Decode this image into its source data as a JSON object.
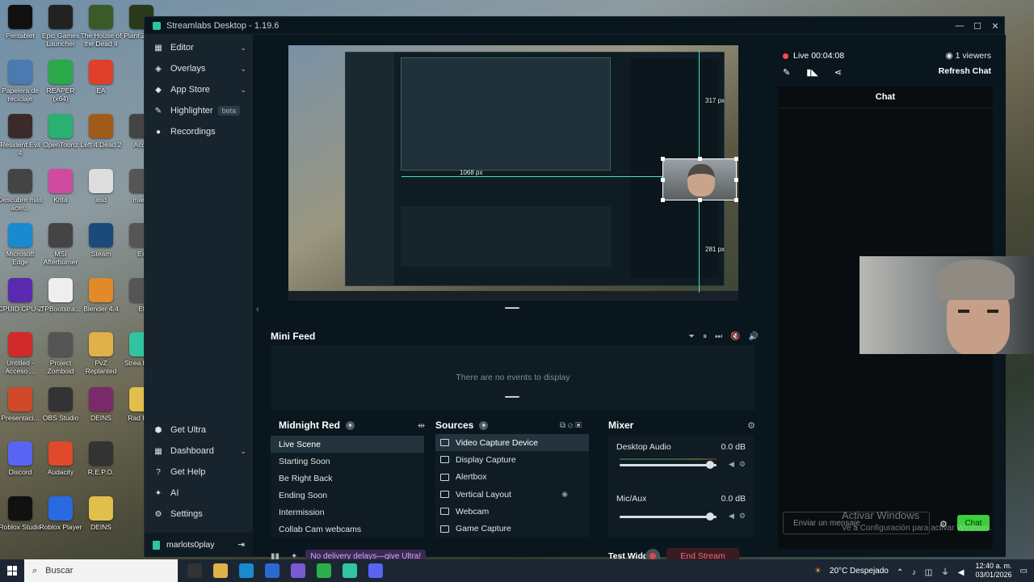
{
  "desktop": {
    "icons": [
      {
        "label": "Pentablet",
        "color": "#111"
      },
      {
        "label": "Epic Games Launcher",
        "color": "#222"
      },
      {
        "label": "The House of the Dead II",
        "color": "#3a5a2a"
      },
      {
        "label": "Plant Zomb",
        "color": "#2a3a1a"
      },
      {
        "label": "Papelera de reciclaje",
        "color": "#4a7ab0"
      },
      {
        "label": "REAPER (x64)",
        "color": "#2aa84a"
      },
      {
        "label": "EA",
        "color": "#e0402a"
      },
      {
        "label": "Resident Evil 4",
        "color": "#3a2a2a"
      },
      {
        "label": "OpenToonz",
        "color": "#2ab070"
      },
      {
        "label": "Left 4 Dead 2",
        "color": "#a05a1a"
      },
      {
        "label": "Acce",
        "color": "#444"
      },
      {
        "label": "Descubre más acer...",
        "color": "#444"
      },
      {
        "label": "Krita",
        "color": "#d04aa0"
      },
      {
        "label": "asd",
        "color": "#ddd"
      },
      {
        "label": "mand",
        "color": "#555"
      },
      {
        "label": "Microsoft Edge",
        "color": "#1a8ad0"
      },
      {
        "label": "MSI Afterburner",
        "color": "#444"
      },
      {
        "label": "Steam",
        "color": "#1a4a7a"
      },
      {
        "label": "Ex",
        "color": "#555"
      },
      {
        "label": "CPUID CPU-Z",
        "color": "#5a2ab0"
      },
      {
        "label": "TPBootstra...",
        "color": "#eee"
      },
      {
        "label": "Blender 4.4",
        "color": "#e08a2a"
      },
      {
        "label": "El",
        "color": "#555"
      },
      {
        "label": "Untitled - Acceso ...",
        "color": "#d02a2a"
      },
      {
        "label": "Project Zomboid",
        "color": "#555"
      },
      {
        "label": "PvZ Replanted",
        "color": "#e0b04a"
      },
      {
        "label": "Strea Desk",
        "color": "#31c3a2"
      },
      {
        "label": "Presentaci...",
        "color": "#d04a2a"
      },
      {
        "label": "OBS Studio",
        "color": "#333"
      },
      {
        "label": "DEINS",
        "color": "#7a2a6a"
      },
      {
        "label": "Rad ReL",
        "color": "#e0c04a"
      },
      {
        "label": "Discord",
        "color": "#5865f2"
      },
      {
        "label": "Audacity",
        "color": "#e04a2a"
      },
      {
        "label": "R.E.P.O.",
        "color": "#333"
      },
      {
        "label": "Roblox Studio",
        "color": "#111"
      },
      {
        "label": "Roblox Player",
        "color": "#2a6ae0"
      },
      {
        "label": "DEINS",
        "color": "#e0c04a"
      }
    ]
  },
  "window": {
    "title": "Streamlabs Desktop - 1.19.6",
    "min": "—",
    "max": "☐",
    "close": "✕"
  },
  "sidebar": {
    "items": [
      {
        "label": "Editor",
        "icon": "▦"
      },
      {
        "label": "Overlays",
        "icon": "◈"
      },
      {
        "label": "App Store",
        "icon": "◆"
      },
      {
        "label": "Highlighter",
        "icon": "✎",
        "badge": "beta"
      },
      {
        "label": "Recordings",
        "icon": "●"
      }
    ],
    "bottom": [
      {
        "label": "Get Ultra",
        "icon": "⬢"
      },
      {
        "label": "Dashboard",
        "icon": "▦"
      },
      {
        "label": "Get Help",
        "icon": "?"
      },
      {
        "label": "AI",
        "icon": "✦"
      },
      {
        "label": "Settings",
        "icon": "⚙"
      }
    ],
    "user": "marlots0play",
    "logout_icon": "⇥"
  },
  "preview": {
    "guide_width_label": "1068 px",
    "top_label": "317 px",
    "bottom_label": "281 px"
  },
  "mini_feed": {
    "title": "Mini Feed",
    "empty": "There are no events to display",
    "controls": [
      "⏷",
      "⏸",
      "⏭",
      "🔇",
      "🔊"
    ]
  },
  "scenes": {
    "title": "Midnight Red",
    "items": [
      "Live Scene",
      "Starting Soon",
      "Be Right Back",
      "Ending Soon",
      "Intermission",
      "Collab Cam webcams"
    ],
    "active": 0
  },
  "sources": {
    "title": "Sources",
    "items": [
      "Video Capture Device",
      "Display Capture",
      "Alertbox",
      "Vertical Layout",
      "Webcam",
      "Game Capture"
    ]
  },
  "mixer": {
    "title": "Mixer",
    "channels": [
      {
        "name": "Desktop Audio",
        "level": "0.0 dB"
      },
      {
        "name": "Mic/Aux",
        "level": "0.0 dB"
      }
    ]
  },
  "footer": {
    "ultra_promo": "No delivery delays—give Ultra!",
    "test_widgets": "Test Widgets",
    "end_stream": "End Stream"
  },
  "live": {
    "status": "Live",
    "time": "00:04:08",
    "viewers": "1 viewers",
    "refresh": "Refresh Chat",
    "chat_title": "Chat",
    "chat_placeholder": "Enviar un mensaje",
    "chat_button": "Chat"
  },
  "watermark": {
    "line1": "Activar Windows",
    "line2": "Ve a Configuración para activar Windows."
  },
  "taskbar": {
    "search": "Buscar",
    "weather": "20°C  Despejado",
    "time": "12:40 a. m.",
    "date": "03/01/2026"
  },
  "colors": {
    "accent": "#31c3a2",
    "live": "#ff4a4a",
    "chat_button": "#3ad03a",
    "end_stream_text": "#ff6474"
  }
}
